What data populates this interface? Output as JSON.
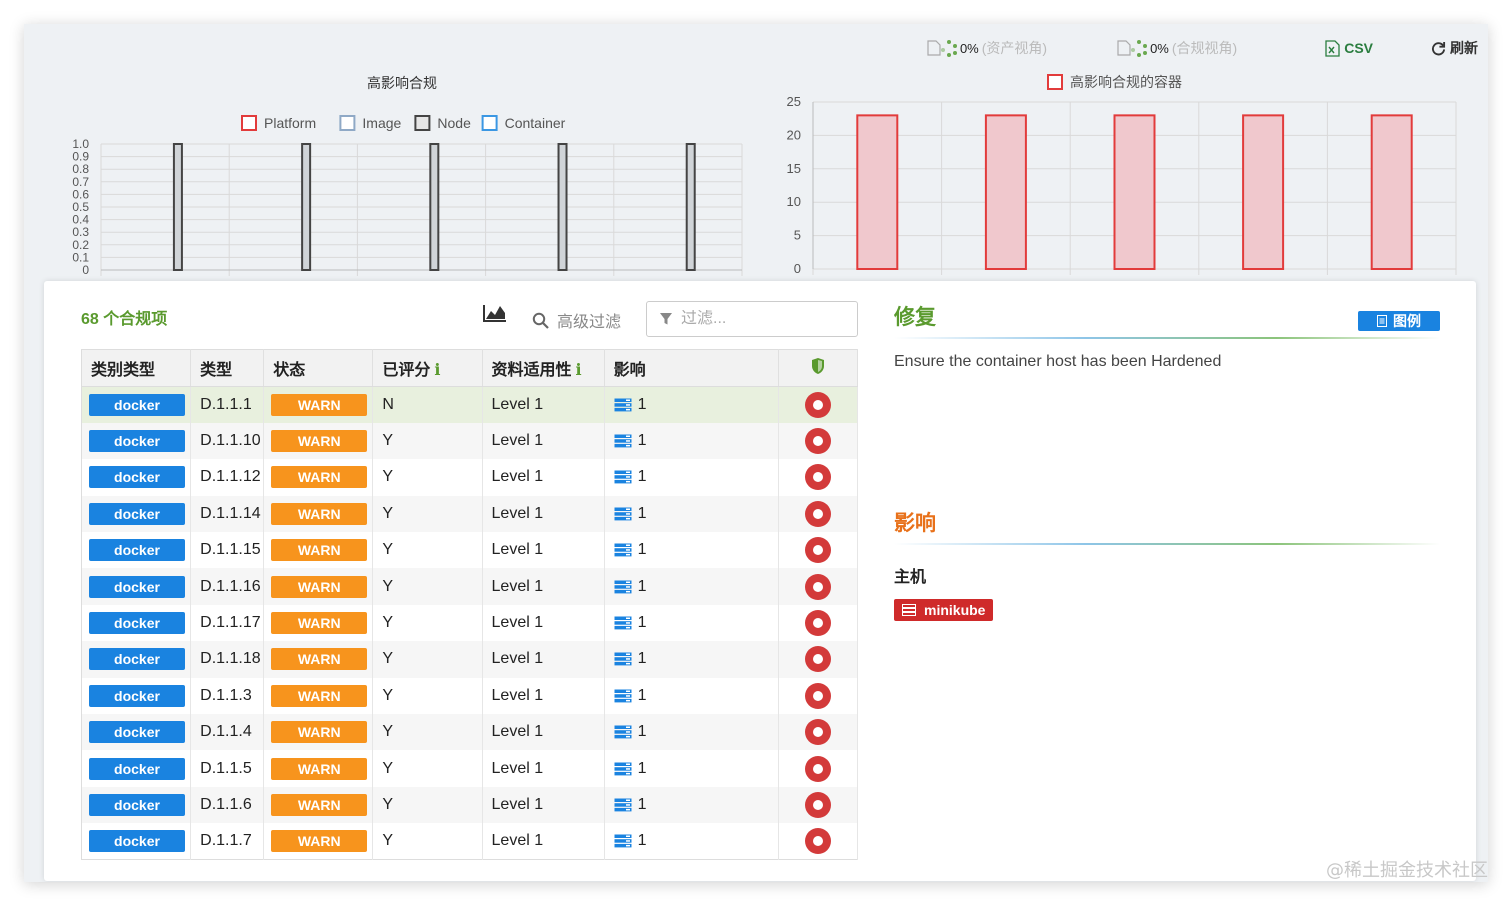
{
  "toolbar": {
    "progress_1_pct": "0%",
    "progress_1_label": "(资产视角)",
    "progress_2_pct": "0%",
    "progress_2_label": "(合规视角)",
    "csv_label": "CSV",
    "refresh_label": "刷新"
  },
  "colors": {
    "green_title": "#5a9a2e",
    "docker_badge": "#1a83e0",
    "warn_badge": "#f7941d",
    "red_dot": "#d33a3a",
    "impact_title": "#e8711a",
    "host_badge": "#cf2a2a"
  },
  "chart_data": [
    {
      "type": "bar",
      "title": "高影响合规",
      "legend": [
        "Platform",
        "Image",
        "Node",
        "Container"
      ],
      "legend_placement": "top",
      "categories": [
        "",
        "",
        "",
        "",
        ""
      ],
      "series": [
        {
          "name": "Platform",
          "values": [
            0,
            0,
            0,
            0,
            0
          ],
          "color": "#e23b3b"
        },
        {
          "name": "Image",
          "values": [
            0,
            0,
            0,
            0,
            0
          ],
          "color": "#8fa9c6"
        },
        {
          "name": "Node",
          "values": [
            1,
            1,
            1,
            1,
            1
          ],
          "color": "#444444"
        },
        {
          "name": "Container",
          "values": [
            0,
            0,
            0,
            0,
            0
          ],
          "color": "#3b97e3"
        }
      ],
      "yticks": [
        "1.0",
        "0.9",
        "0.8",
        "0.7",
        "0.6",
        "0.5",
        "0.4",
        "0.3",
        "0.2",
        "0.1",
        "0"
      ],
      "ylim": [
        0,
        1
      ],
      "grid": true
    },
    {
      "type": "bar",
      "title": "",
      "legend": [
        "高影响合规的容器"
      ],
      "legend_placement": "top",
      "categories": [
        "",
        "",
        "",
        "",
        ""
      ],
      "series": [
        {
          "name": "高影响合规的容器",
          "values": [
            23,
            23,
            23,
            23,
            23
          ],
          "color": "#e23b3b"
        }
      ],
      "yticks": [
        "25",
        "20",
        "15",
        "10",
        "5",
        "0"
      ],
      "ylim": [
        0,
        25
      ],
      "grid": true
    }
  ],
  "list": {
    "count_title": "68 个合规项",
    "advanced_filter_label": "高级过滤",
    "filter_placeholder": "过滤...",
    "columns": [
      "类别类型",
      "类型",
      "状态",
      "已评分",
      "资料适用性",
      "影响"
    ],
    "info_icon": "i",
    "rows": [
      {
        "category": "docker",
        "type": "D.1.1.1",
        "status": "WARN",
        "scored": "N",
        "profile": "Level 1",
        "impact": "1"
      },
      {
        "category": "docker",
        "type": "D.1.1.10",
        "status": "WARN",
        "scored": "Y",
        "profile": "Level 1",
        "impact": "1"
      },
      {
        "category": "docker",
        "type": "D.1.1.12",
        "status": "WARN",
        "scored": "Y",
        "profile": "Level 1",
        "impact": "1"
      },
      {
        "category": "docker",
        "type": "D.1.1.14",
        "status": "WARN",
        "scored": "Y",
        "profile": "Level 1",
        "impact": "1"
      },
      {
        "category": "docker",
        "type": "D.1.1.15",
        "status": "WARN",
        "scored": "Y",
        "profile": "Level 1",
        "impact": "1"
      },
      {
        "category": "docker",
        "type": "D.1.1.16",
        "status": "WARN",
        "scored": "Y",
        "profile": "Level 1",
        "impact": "1"
      },
      {
        "category": "docker",
        "type": "D.1.1.17",
        "status": "WARN",
        "scored": "Y",
        "profile": "Level 1",
        "impact": "1"
      },
      {
        "category": "docker",
        "type": "D.1.1.18",
        "status": "WARN",
        "scored": "Y",
        "profile": "Level 1",
        "impact": "1"
      },
      {
        "category": "docker",
        "type": "D.1.1.3",
        "status": "WARN",
        "scored": "Y",
        "profile": "Level 1",
        "impact": "1"
      },
      {
        "category": "docker",
        "type": "D.1.1.4",
        "status": "WARN",
        "scored": "Y",
        "profile": "Level 1",
        "impact": "1"
      },
      {
        "category": "docker",
        "type": "D.1.1.5",
        "status": "WARN",
        "scored": "Y",
        "profile": "Level 1",
        "impact": "1"
      },
      {
        "category": "docker",
        "type": "D.1.1.6",
        "status": "WARN",
        "scored": "Y",
        "profile": "Level 1",
        "impact": "1"
      },
      {
        "category": "docker",
        "type": "D.1.1.7",
        "status": "WARN",
        "scored": "Y",
        "profile": "Level 1",
        "impact": "1"
      }
    ]
  },
  "detail": {
    "fix_title": "修复",
    "legend_button": "图例",
    "fix_text": "Ensure the container host has been Hardened",
    "impact_title": "影响",
    "host_label": "主机",
    "host_value": "minikube"
  },
  "watermark": "@稀土掘金技术社区"
}
